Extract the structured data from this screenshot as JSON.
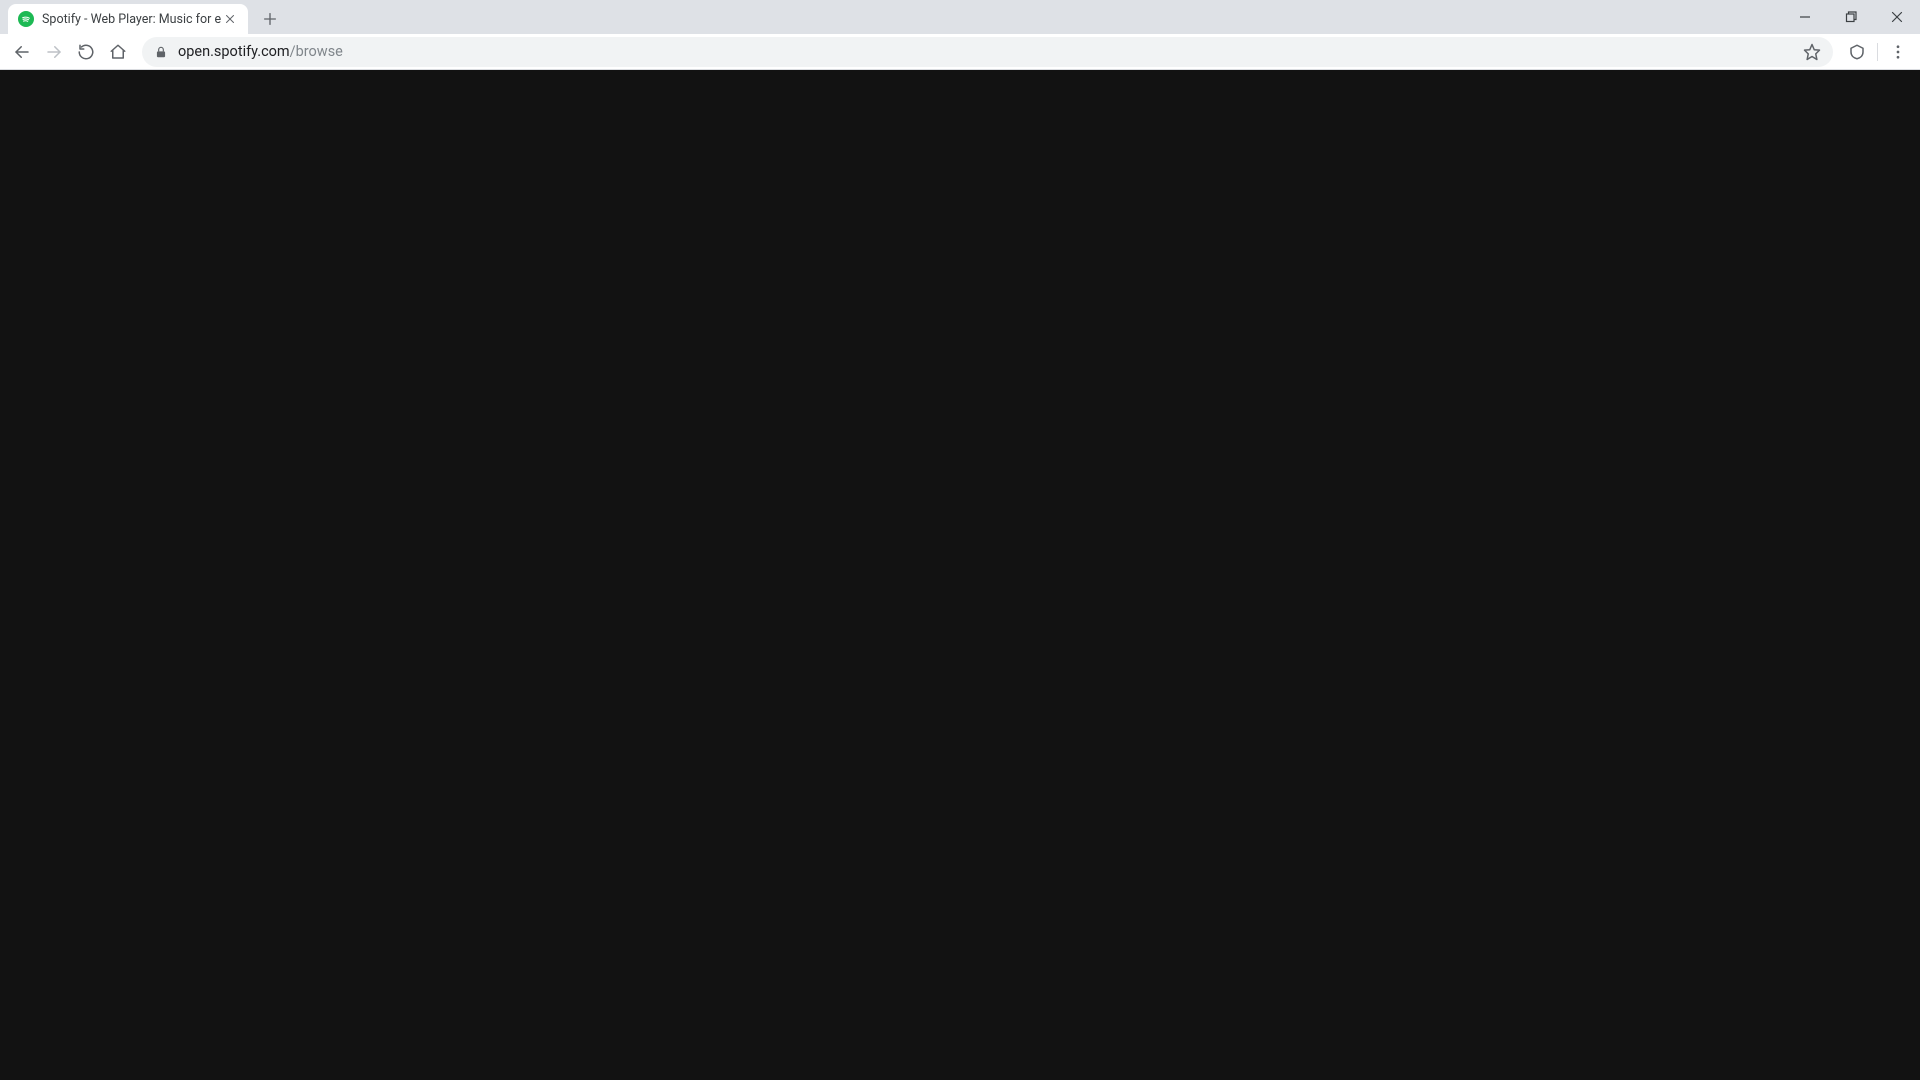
{
  "tab": {
    "title": "Spotify - Web Player: Music for e",
    "favicon_accent": "#1db954"
  },
  "address": {
    "host": "open.spotify.com",
    "path": "/browse"
  },
  "colors": {
    "page_bg": "#121212",
    "tabstrip_bg": "#dee1e6"
  }
}
